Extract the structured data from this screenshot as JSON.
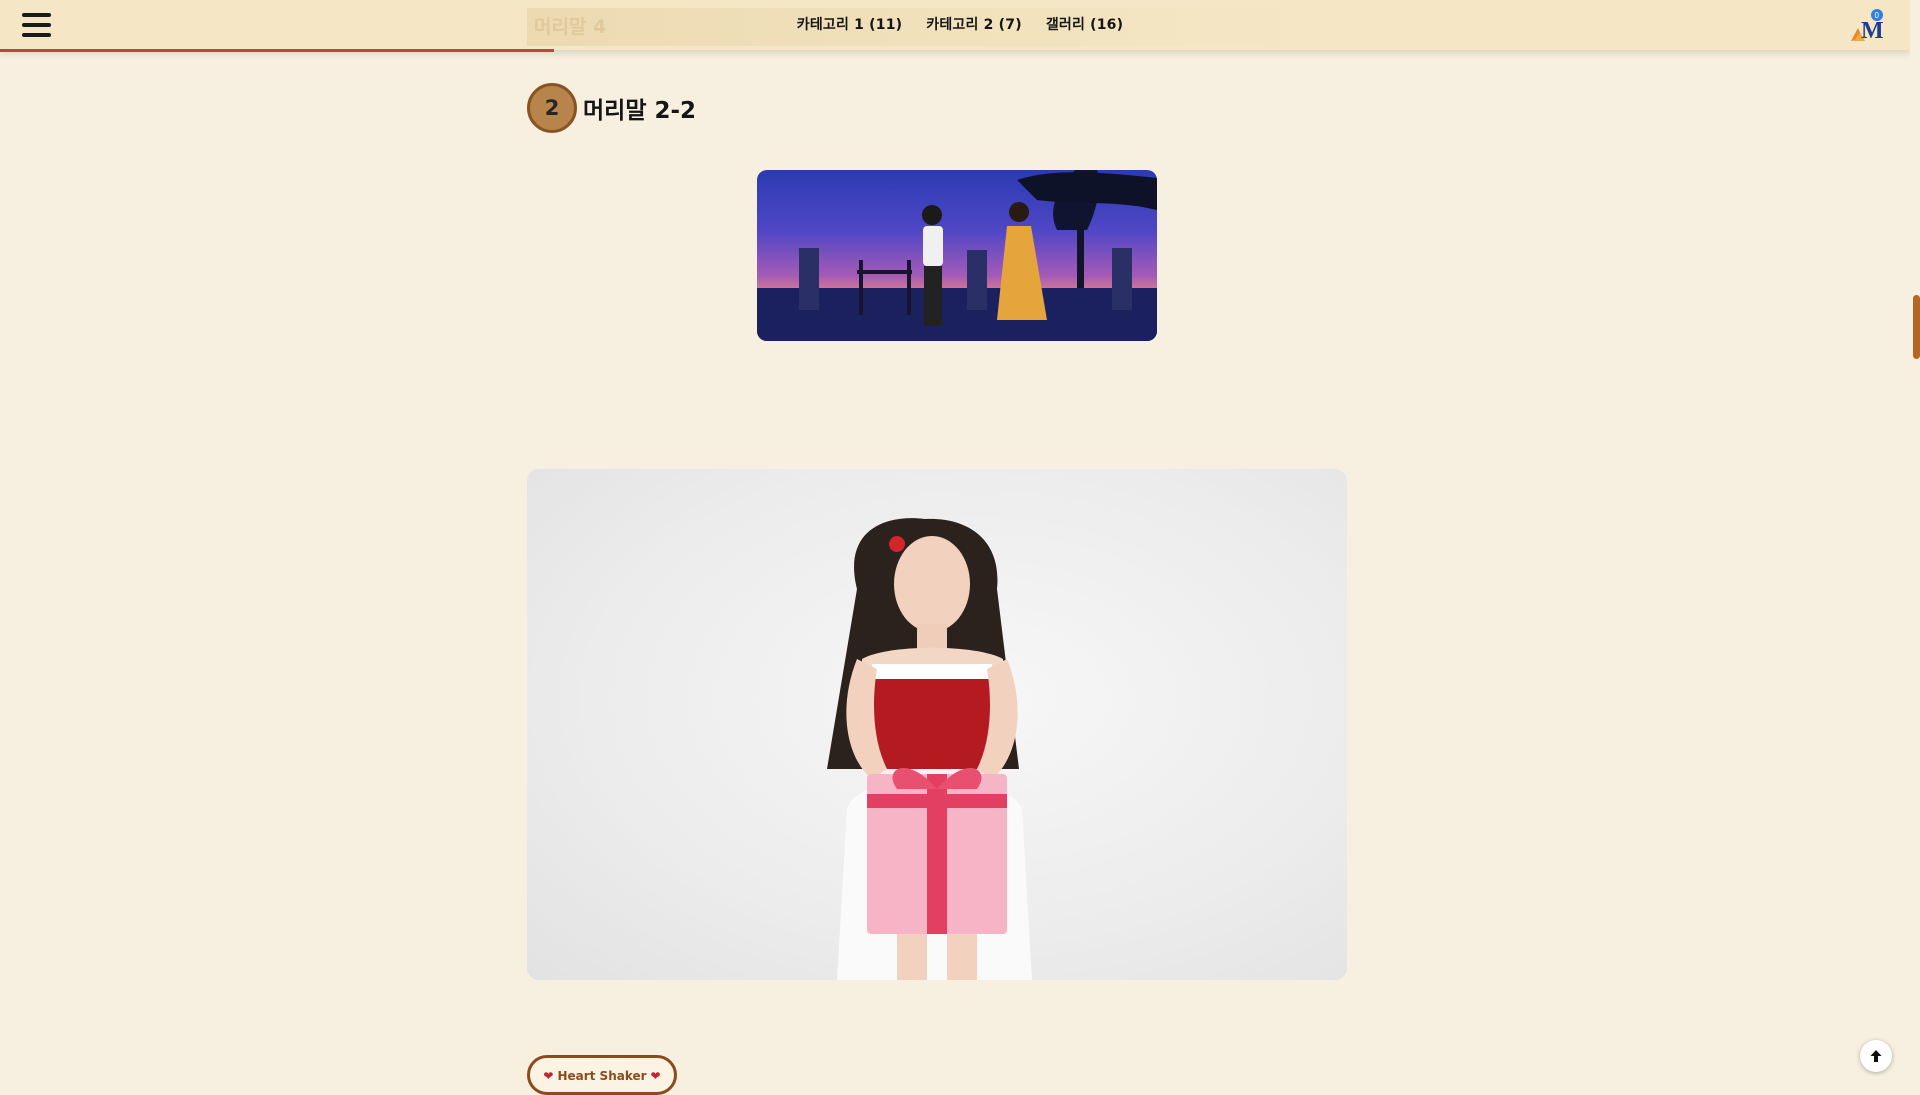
{
  "header": {
    "ghost_title": "머리말 4",
    "nav": [
      {
        "label": "카테고리 1 (11)"
      },
      {
        "label": "카테고리 2 (7)"
      },
      {
        "label": "갤러리 (16)"
      }
    ],
    "logo_letter": "M",
    "logo_badge": "0"
  },
  "reading_progress": 0.29,
  "section": {
    "number": "2",
    "title": "머리말 2-2"
  },
  "tag_button": {
    "label": "Heart Shaker",
    "icon": "heart-icon"
  },
  "colors": {
    "background": "#f7f0e1",
    "header": "#f5e7c6",
    "accent": "#8d4a1a",
    "progress": "#b8473f",
    "badge": "#b7844c",
    "scrollbar": "#b56622"
  },
  "icons": [
    "hamburger-menu-icon",
    "logo-icon",
    "heart-icon",
    "arrow-up-icon"
  ]
}
